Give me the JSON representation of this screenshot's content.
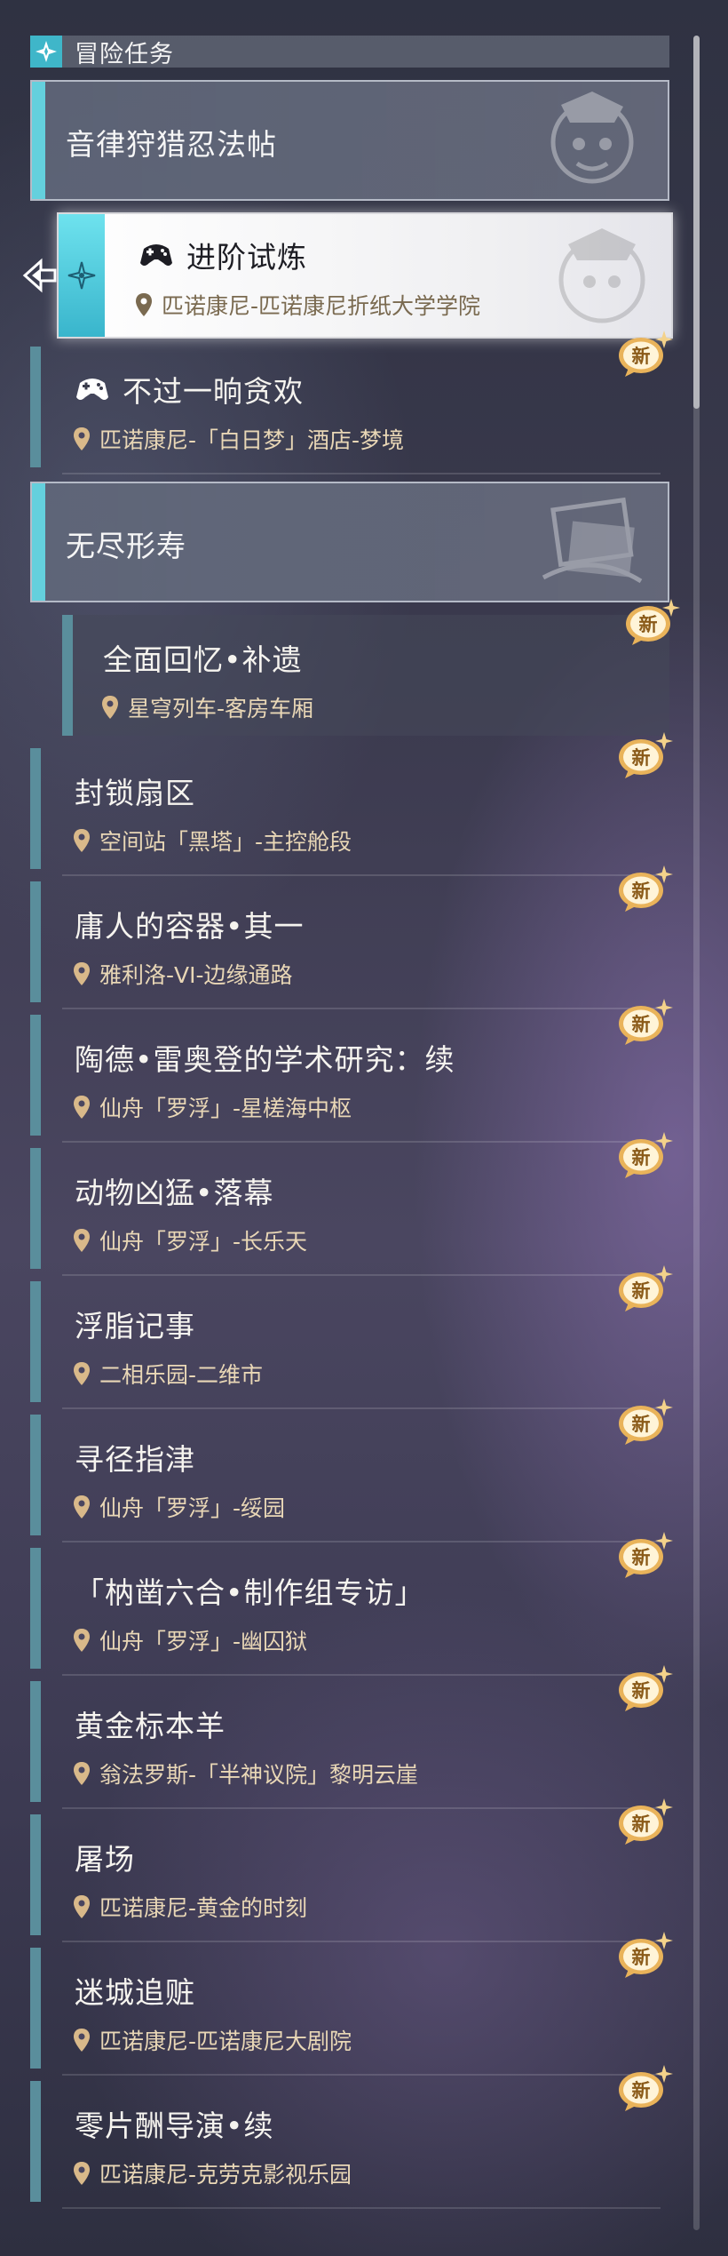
{
  "header": {
    "title": "冒险任务",
    "icon": "diamond-star-icon"
  },
  "categories": [
    {
      "label": "音律狩猎忍法帖"
    },
    {
      "label": "无尽形寿"
    }
  ],
  "selected_quest": {
    "title": "进阶试炼",
    "location": "匹诺康尼-匹诺康尼折纸大学学院",
    "icon": "gamepad-icon"
  },
  "badge_text": "新",
  "quests": [
    {
      "title": "不过一晌贪欢",
      "location": "匹诺康尼-「白日梦」酒店-梦境",
      "icon": "gamepad-icon"
    },
    {
      "title": "全面回忆•补遗",
      "location": "星穹列车-客房车厢"
    },
    {
      "title": "封锁扇区",
      "location": "空间站「黑塔」-主控舱段"
    },
    {
      "title": "庸人的容器•其一",
      "location": "雅利洛-VI-边缘通路"
    },
    {
      "title": "陶德•雷奥登的学术研究：续",
      "location": "仙舟「罗浮」-星槎海中枢"
    },
    {
      "title": "动物凶猛•落幕",
      "location": "仙舟「罗浮」-长乐天"
    },
    {
      "title": "浮脂记事",
      "location": "二相乐园-二维市"
    },
    {
      "title": "寻径指津",
      "location": "仙舟「罗浮」-绥园"
    },
    {
      "title": "「枘凿六合•制作组专访」",
      "location": "仙舟「罗浮」-幽囚狱"
    },
    {
      "title": "黄金标本羊",
      "location": "翁法罗斯-「半神议院」黎明云崖"
    },
    {
      "title": "屠场",
      "location": "匹诺康尼-黄金的时刻"
    },
    {
      "title": "迷城追赃",
      "location": "匹诺康尼-匹诺康尼大剧院"
    },
    {
      "title": "零片酬导演•续",
      "location": "匹诺康尼-克劳克影视乐园"
    }
  ],
  "colors": {
    "accent": "#64d0dd",
    "bar": "#5a8e9c",
    "location_text": "#e9d7b6",
    "badge_gold": "#e9b35a"
  }
}
